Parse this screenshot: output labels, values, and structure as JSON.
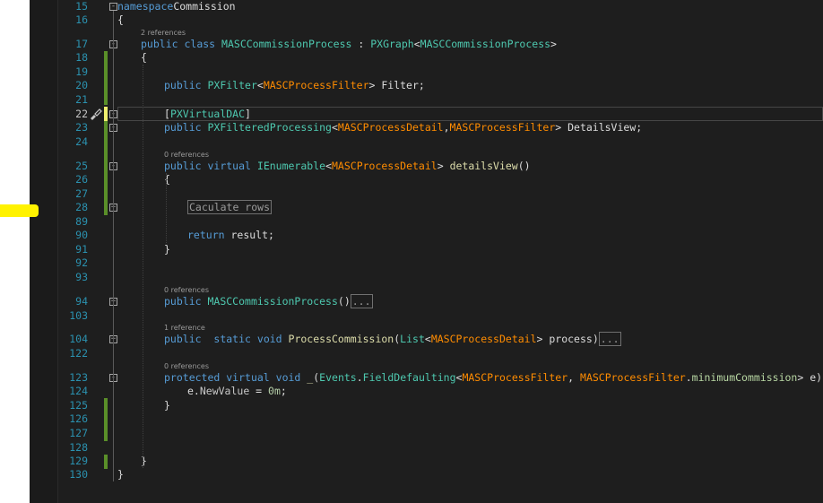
{
  "editor": {
    "lines": [
      {
        "n": "15",
        "parts": [
          [
            "kw",
            "namespace"
          ],
          [
            "",
            "Commission"
          ]
        ]
      },
      {
        "n": "16",
        "parts": [
          [
            "",
            "{"
          ]
        ]
      },
      {
        "n": "17",
        "parts": [
          [
            "kw",
            "public"
          ],
          [
            "",
            " "
          ],
          [
            "kw",
            "class"
          ],
          [
            "",
            " "
          ],
          [
            "type",
            "MASCCommissionProcess"
          ],
          [
            "",
            " : "
          ],
          [
            "type",
            "PXGraph"
          ],
          [
            "",
            "<"
          ],
          [
            "type",
            "MASCCommissionProcess"
          ],
          [
            "",
            ">"
          ]
        ]
      },
      {
        "n": "18",
        "parts": [
          [
            "",
            "{"
          ]
        ]
      },
      {
        "n": "19",
        "parts": []
      },
      {
        "n": "20",
        "parts": [
          [
            "kw",
            "public"
          ],
          [
            "",
            " "
          ],
          [
            "type",
            "PXFilter"
          ],
          [
            "",
            "<"
          ],
          [
            "orange",
            "MASCProcessFilter"
          ],
          [
            "",
            "> Filter;"
          ]
        ]
      },
      {
        "n": "21",
        "parts": []
      },
      {
        "n": "22",
        "parts": [
          [
            "",
            "["
          ],
          [
            "type",
            "PXVirtualDAC"
          ],
          [
            "",
            "]"
          ]
        ]
      },
      {
        "n": "23",
        "parts": [
          [
            "kw",
            "public"
          ],
          [
            "",
            " "
          ],
          [
            "type",
            "PXFilteredProcessing"
          ],
          [
            "",
            "<"
          ],
          [
            "orange",
            "MASCProcessDetail"
          ],
          [
            "",
            ","
          ],
          [
            "orange",
            "MASCProcessFilter"
          ],
          [
            "",
            "> DetailsView;"
          ]
        ]
      },
      {
        "n": "24",
        "parts": []
      },
      {
        "n": "25",
        "parts": [
          [
            "kw",
            "public"
          ],
          [
            "",
            " "
          ],
          [
            "kw",
            "virtual"
          ],
          [
            "",
            " "
          ],
          [
            "type",
            "IEnumerable"
          ],
          [
            "",
            "<"
          ],
          [
            "orange",
            "MASCProcessDetail"
          ],
          [
            "",
            "> "
          ],
          [
            "method",
            "detailsView"
          ],
          [
            "",
            "()"
          ]
        ]
      },
      {
        "n": "26",
        "parts": [
          [
            "",
            "{"
          ]
        ]
      },
      {
        "n": "27",
        "parts": []
      },
      {
        "n": "28",
        "parts": [
          [
            "box",
            "Caculate rows"
          ]
        ]
      },
      {
        "n": "89",
        "parts": []
      },
      {
        "n": "90",
        "parts": [
          [
            "kw",
            "return"
          ],
          [
            "",
            " result;"
          ]
        ]
      },
      {
        "n": "91",
        "parts": [
          [
            "",
            "}"
          ]
        ]
      },
      {
        "n": "92",
        "parts": []
      },
      {
        "n": "93",
        "parts": []
      },
      {
        "n": "94",
        "parts": [
          [
            "kw",
            "public"
          ],
          [
            "",
            " "
          ],
          [
            "type",
            "MASCCommissionProcess"
          ],
          [
            "",
            "()"
          ],
          [
            "box",
            "..."
          ]
        ]
      },
      {
        "n": "103",
        "parts": []
      },
      {
        "n": "104",
        "parts": [
          [
            "kw",
            "public"
          ],
          [
            "",
            "  "
          ],
          [
            "kw",
            "static"
          ],
          [
            "",
            " "
          ],
          [
            "kw",
            "void"
          ],
          [
            "",
            " "
          ],
          [
            "method",
            "ProcessCommission"
          ],
          [
            "",
            "("
          ],
          [
            "type",
            "List"
          ],
          [
            "",
            "<"
          ],
          [
            "orange",
            "MASCProcessDetail"
          ],
          [
            "",
            "> process)"
          ],
          [
            "box",
            "..."
          ]
        ]
      },
      {
        "n": "122",
        "parts": []
      },
      {
        "n": "123",
        "parts": [
          [
            "kw",
            "protected"
          ],
          [
            "",
            " "
          ],
          [
            "kw",
            "virtual"
          ],
          [
            "",
            " "
          ],
          [
            "kw",
            "void"
          ],
          [
            "",
            " "
          ],
          [
            "method",
            "_"
          ],
          [
            "",
            "("
          ],
          [
            "type",
            "Events"
          ],
          [
            "",
            "."
          ],
          [
            "type",
            "FieldDefaulting"
          ],
          [
            "",
            "<"
          ],
          [
            "orange",
            "MASCProcessFilter"
          ],
          [
            "",
            ", "
          ],
          [
            "orange",
            "MASCProcessFilter"
          ],
          [
            "",
            "."
          ],
          [
            "green-field",
            "minimumCommission"
          ],
          [
            "",
            "> e) {"
          ]
        ]
      },
      {
        "n": "124",
        "parts": [
          [
            "",
            "e."
          ],
          [
            "prop",
            "NewValue"
          ],
          [
            "",
            " = "
          ],
          [
            "num",
            "0m"
          ],
          [
            "",
            ";"
          ]
        ]
      },
      {
        "n": "125",
        "parts": [
          [
            "",
            "}"
          ]
        ]
      },
      {
        "n": "126",
        "parts": []
      },
      {
        "n": "127",
        "parts": []
      },
      {
        "n": "128",
        "parts": []
      },
      {
        "n": "129",
        "parts": [
          [
            "",
            "}"
          ]
        ]
      },
      {
        "n": "130",
        "parts": [
          [
            "",
            "}"
          ]
        ]
      }
    ],
    "codelens": {
      "class_refs": "2 references",
      "details_refs": "0 references",
      "ctor_refs": "0 references",
      "process_refs": "1 reference",
      "defaulting_refs": "0 references"
    },
    "icons": {
      "fold_expanded": "minus-box-icon",
      "fold_collapsed": "plus-box-icon",
      "quick_action": "paintbrush-icon"
    },
    "colors": {
      "background": "#1e1e1e",
      "keyword": "#569cd6",
      "type": "#4ec9b0",
      "dac": "#ff8c00",
      "line_number": "#2b91af",
      "change_saved": "#5a8f29",
      "change_unsaved": "#efef6e",
      "highlight_marker": "#fff200"
    }
  }
}
